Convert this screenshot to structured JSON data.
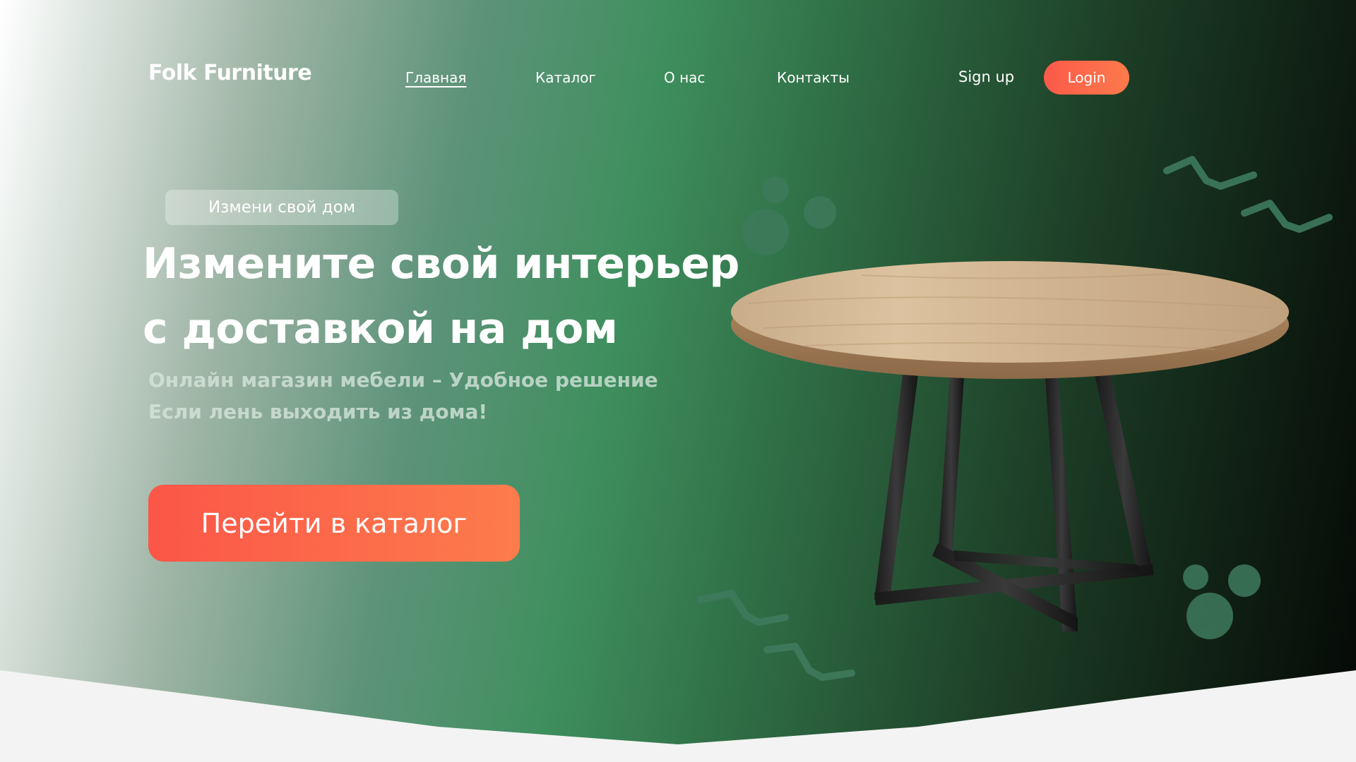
{
  "brand": {
    "name": "Folk Furniture"
  },
  "nav": {
    "items": [
      {
        "label": "Главная",
        "active": true
      },
      {
        "label": "Каталог",
        "active": false
      },
      {
        "label": "О нас",
        "active": false
      },
      {
        "label": "Контакты",
        "active": false
      }
    ]
  },
  "auth": {
    "signup_label": "Sign up",
    "login_label": "Login"
  },
  "hero": {
    "tag": "Измени свой дом",
    "headline": [
      "Измените свой интерьер",
      "с доставкой на дом"
    ],
    "subtitle": [
      "Онлайн магазин мебели – Удобное решение",
      "Если лень выходить из дома!"
    ],
    "cta_label": "Перейти в каталог"
  },
  "colors": {
    "accent": "#fb5a4a",
    "accent_light": "#fd7a4b",
    "green": "#3f8f5e",
    "dark": "#050805",
    "decor": "#3e7a5c"
  },
  "icons": {
    "product_image": "round-wooden-table",
    "decorations": [
      "dots-cluster",
      "zigzag-lines"
    ]
  }
}
